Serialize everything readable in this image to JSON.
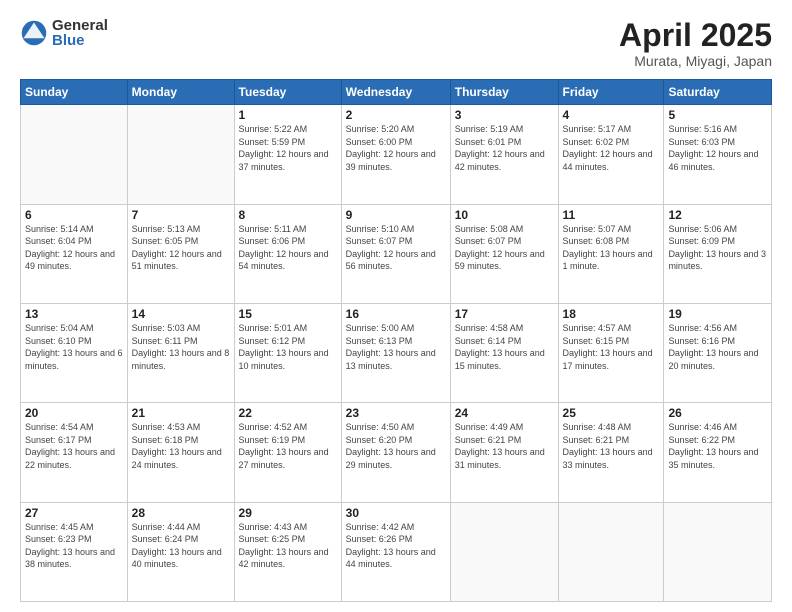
{
  "logo": {
    "general": "General",
    "blue": "Blue"
  },
  "header": {
    "title": "April 2025",
    "subtitle": "Murata, Miyagi, Japan"
  },
  "weekdays": [
    "Sunday",
    "Monday",
    "Tuesday",
    "Wednesday",
    "Thursday",
    "Friday",
    "Saturday"
  ],
  "days": [
    {
      "day": "",
      "info": ""
    },
    {
      "day": "",
      "info": ""
    },
    {
      "day": "1",
      "info": "Sunrise: 5:22 AM\nSunset: 5:59 PM\nDaylight: 12 hours and 37 minutes."
    },
    {
      "day": "2",
      "info": "Sunrise: 5:20 AM\nSunset: 6:00 PM\nDaylight: 12 hours and 39 minutes."
    },
    {
      "day": "3",
      "info": "Sunrise: 5:19 AM\nSunset: 6:01 PM\nDaylight: 12 hours and 42 minutes."
    },
    {
      "day": "4",
      "info": "Sunrise: 5:17 AM\nSunset: 6:02 PM\nDaylight: 12 hours and 44 minutes."
    },
    {
      "day": "5",
      "info": "Sunrise: 5:16 AM\nSunset: 6:03 PM\nDaylight: 12 hours and 46 minutes."
    },
    {
      "day": "6",
      "info": "Sunrise: 5:14 AM\nSunset: 6:04 PM\nDaylight: 12 hours and 49 minutes."
    },
    {
      "day": "7",
      "info": "Sunrise: 5:13 AM\nSunset: 6:05 PM\nDaylight: 12 hours and 51 minutes."
    },
    {
      "day": "8",
      "info": "Sunrise: 5:11 AM\nSunset: 6:06 PM\nDaylight: 12 hours and 54 minutes."
    },
    {
      "day": "9",
      "info": "Sunrise: 5:10 AM\nSunset: 6:07 PM\nDaylight: 12 hours and 56 minutes."
    },
    {
      "day": "10",
      "info": "Sunrise: 5:08 AM\nSunset: 6:07 PM\nDaylight: 12 hours and 59 minutes."
    },
    {
      "day": "11",
      "info": "Sunrise: 5:07 AM\nSunset: 6:08 PM\nDaylight: 13 hours and 1 minute."
    },
    {
      "day": "12",
      "info": "Sunrise: 5:06 AM\nSunset: 6:09 PM\nDaylight: 13 hours and 3 minutes."
    },
    {
      "day": "13",
      "info": "Sunrise: 5:04 AM\nSunset: 6:10 PM\nDaylight: 13 hours and 6 minutes."
    },
    {
      "day": "14",
      "info": "Sunrise: 5:03 AM\nSunset: 6:11 PM\nDaylight: 13 hours and 8 minutes."
    },
    {
      "day": "15",
      "info": "Sunrise: 5:01 AM\nSunset: 6:12 PM\nDaylight: 13 hours and 10 minutes."
    },
    {
      "day": "16",
      "info": "Sunrise: 5:00 AM\nSunset: 6:13 PM\nDaylight: 13 hours and 13 minutes."
    },
    {
      "day": "17",
      "info": "Sunrise: 4:58 AM\nSunset: 6:14 PM\nDaylight: 13 hours and 15 minutes."
    },
    {
      "day": "18",
      "info": "Sunrise: 4:57 AM\nSunset: 6:15 PM\nDaylight: 13 hours and 17 minutes."
    },
    {
      "day": "19",
      "info": "Sunrise: 4:56 AM\nSunset: 6:16 PM\nDaylight: 13 hours and 20 minutes."
    },
    {
      "day": "20",
      "info": "Sunrise: 4:54 AM\nSunset: 6:17 PM\nDaylight: 13 hours and 22 minutes."
    },
    {
      "day": "21",
      "info": "Sunrise: 4:53 AM\nSunset: 6:18 PM\nDaylight: 13 hours and 24 minutes."
    },
    {
      "day": "22",
      "info": "Sunrise: 4:52 AM\nSunset: 6:19 PM\nDaylight: 13 hours and 27 minutes."
    },
    {
      "day": "23",
      "info": "Sunrise: 4:50 AM\nSunset: 6:20 PM\nDaylight: 13 hours and 29 minutes."
    },
    {
      "day": "24",
      "info": "Sunrise: 4:49 AM\nSunset: 6:21 PM\nDaylight: 13 hours and 31 minutes."
    },
    {
      "day": "25",
      "info": "Sunrise: 4:48 AM\nSunset: 6:21 PM\nDaylight: 13 hours and 33 minutes."
    },
    {
      "day": "26",
      "info": "Sunrise: 4:46 AM\nSunset: 6:22 PM\nDaylight: 13 hours and 35 minutes."
    },
    {
      "day": "27",
      "info": "Sunrise: 4:45 AM\nSunset: 6:23 PM\nDaylight: 13 hours and 38 minutes."
    },
    {
      "day": "28",
      "info": "Sunrise: 4:44 AM\nSunset: 6:24 PM\nDaylight: 13 hours and 40 minutes."
    },
    {
      "day": "29",
      "info": "Sunrise: 4:43 AM\nSunset: 6:25 PM\nDaylight: 13 hours and 42 minutes."
    },
    {
      "day": "30",
      "info": "Sunrise: 4:42 AM\nSunset: 6:26 PM\nDaylight: 13 hours and 44 minutes."
    },
    {
      "day": "",
      "info": ""
    },
    {
      "day": "",
      "info": ""
    },
    {
      "day": "",
      "info": ""
    },
    {
      "day": "",
      "info": ""
    }
  ]
}
